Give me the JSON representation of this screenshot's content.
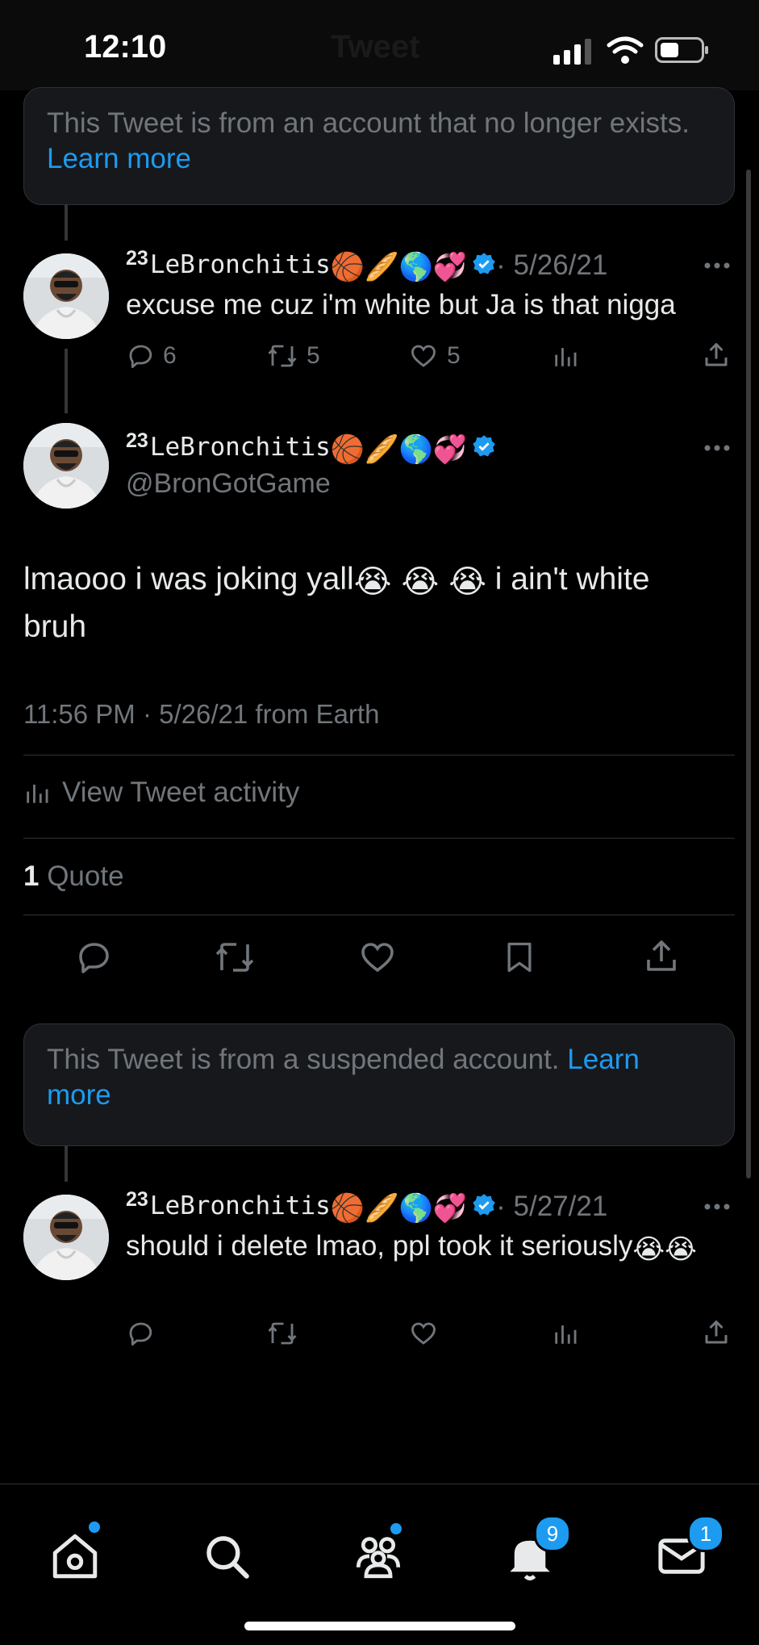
{
  "status_bar": {
    "time": "12:10"
  },
  "header": {
    "title": "Tweet"
  },
  "notice_top": {
    "text": "This Tweet is from an account that no longer exists.",
    "link": "Learn more"
  },
  "reply1": {
    "superscript": "23",
    "name": "LeBronchitis",
    "emojis": [
      "🏀",
      "🥖",
      "🌎",
      "💞"
    ],
    "date": "· 5/26/21",
    "text": "excuse me cuz i'm white but Ja is that nigga",
    "replies": "6",
    "retweets": "5",
    "likes": "5"
  },
  "main_tweet": {
    "superscript": "23",
    "name": "LeBronchitis",
    "emojis": [
      "🏀",
      "🥖",
      "🌎",
      "💞"
    ],
    "handle": "@BronGotGame",
    "text_before": "lmaooo i was joking yall",
    "cry_emoji": "😭",
    "text_after": " i ain't white bruh",
    "timestamp": "11:56 PM · 5/26/21 from Earth",
    "activity": "View Tweet activity",
    "quote_count": "1",
    "quote_label": "Quote"
  },
  "notice_bottom": {
    "text": "This Tweet is from a suspended account.",
    "link": "Learn more"
  },
  "reply2": {
    "superscript": "23",
    "name": "LeBronchitis",
    "emojis": [
      "🏀",
      "🥖",
      "🌎",
      "💞"
    ],
    "date": "· 5/27/21",
    "text": "should i delete lmao, ppl took it seriously",
    "cry_emoji": "😭"
  },
  "tab_bar": {
    "notifications_badge": "9",
    "messages_badge": "1"
  },
  "colors": {
    "accent": "#1d9bf0",
    "background": "#000000",
    "card": "#16181c",
    "muted": "#71767b"
  }
}
